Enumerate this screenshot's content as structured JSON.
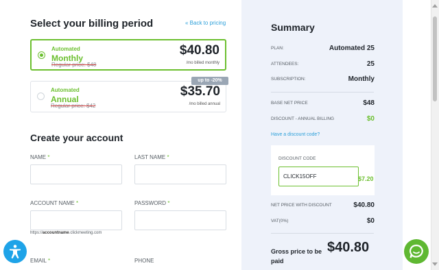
{
  "billing": {
    "heading": "Select your billing period",
    "back_link": "« Back to pricing",
    "plans": [
      {
        "automated": "Automated",
        "name": "Monthly",
        "regular": "Regular price: $48",
        "price": "$40.80",
        "sub": "/mo billed monthly",
        "selected": true
      },
      {
        "automated": "Automated",
        "name": "Annual",
        "regular": "Regular price: $42",
        "price": "$35.70",
        "sub": "/mo billed annual",
        "selected": false,
        "badge": "up to -20%"
      }
    ]
  },
  "account": {
    "heading": "Create your account",
    "name_label": "NAME",
    "lastname_label": "LAST NAME",
    "accountname_label": "ACCOUNT NAME",
    "password_label": "PASSWORD",
    "email_label": "EMAIL",
    "phone_label": "PHONE",
    "required_mark": "*",
    "url_hint_prefix": "https://",
    "url_hint_bold": "accountname",
    "url_hint_suffix": ".clickmeeting.com"
  },
  "summary": {
    "title": "Summary",
    "plan_label": "PLAN:",
    "plan_value": "Automated 25",
    "attendees_label": "ATTENDEES:",
    "attendees_value": "25",
    "subscription_label": "SUBSCRIPTION:",
    "subscription_value": "Monthly",
    "base_label": "BASE NET PRICE",
    "base_value": "$48",
    "discount_label": "DISCOUNT - ANNUAL BILLING",
    "discount_value": "$0",
    "discount_link": "Have a discount code?",
    "code_label": "DISCOUNT CODE",
    "code_value": "CLICK15OFF",
    "code_amount": "$7.20",
    "net_label": "NET PRICE WITH DISCOUNT",
    "net_value": "$40.80",
    "vat_label": "VAT(0%)",
    "vat_value": "$0",
    "gross_label": "Gross price to be paid",
    "gross_value": "$40.80"
  },
  "colors": {
    "accent_green": "#6bbf2e",
    "link_blue": "#2b9fd9",
    "summary_bg": "#eef2fa"
  },
  "icons": {
    "accessibility": "accessibility-icon",
    "chat": "chat-icon"
  }
}
